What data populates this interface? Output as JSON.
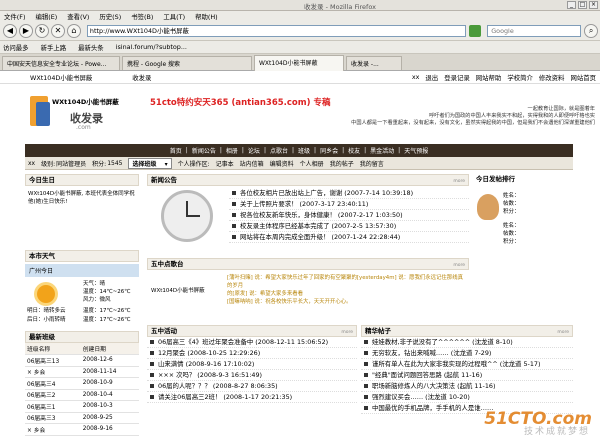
{
  "window": {
    "title": "收发录 - Mozilla Firefox"
  },
  "menu": [
    "文件(F)",
    "编辑(E)",
    "查看(V)",
    "历史(S)",
    "书签(B)",
    "工具(T)",
    "帮助(H)"
  ],
  "address_bar": {
    "url": "http://www.WXt104D小能书屏蔽",
    "search_placeholder": "Google"
  },
  "bookmarks": [
    "访问最多",
    "新手上路",
    "最新头条",
    "isinal.forum/?subtop..."
  ],
  "tabs": [
    "中国安天信息安全专业论坛 - Powe...",
    "携程 - Google 搜索",
    "WXt104D小能书屏蔽",
    "收发录 -..."
  ],
  "active_tab_index": 2,
  "top_links": {
    "left": "WXt104D小能书屏蔽",
    "middle": "收发录",
    "right": [
      "xx",
      "退出",
      "登录记录",
      "网站帮助",
      "学校简介",
      "修改资料",
      "网站首页"
    ]
  },
  "header": {
    "logo_text": "WXt104D小能书屏蔽",
    "logo_sub": "收发录",
    "logo_domain": ".com",
    "slogan": "51cto特约安天365 (antian365.com) 专稿",
    "intro": [
      "一起教育让国际，就是图着年",
      "呼吁者们为国政的中国人丰来我实不和起，实得我和的人即便呼吁格也实",
      "中国人都是一下看重起来，没有起来，没有文化，虽然实得起我的中国，但是我们不会遇他们深谋重建他们"
    ]
  },
  "main_nav": [
    "首页",
    "新闻公告",
    "相册",
    "论坛",
    "点歌台",
    "班级",
    "同乡会",
    "校友",
    "黑金活动",
    "天气预报"
  ],
  "sub_nav": {
    "user": "xx",
    "level_label": "级别:",
    "level": "同站管理员",
    "points_label": "积分:",
    "points": "1545",
    "class_select": "选择班级",
    "links": [
      "个人操作区:",
      "记事本",
      "站内信箱",
      "编辑资料",
      "个人相册",
      "我的帖子",
      "我的留言"
    ]
  },
  "birthday": {
    "title": "今日生日",
    "text": "WXt104D小能书屏蔽, 本班代表全体同学祝他(她)生日快乐!"
  },
  "weather": {
    "title": "本市天气",
    "city": "广州今日",
    "line1": "天气：晴",
    "line2": "温度：14℃~26℃",
    "line3": "风力：微风",
    "tomorrow_label": "明日：晴转多云",
    "tomorrow_temp": "温度：17℃~26℃",
    "after_label": "后日：小雨转晴",
    "after_temp": "温度：17℃~26℃"
  },
  "newest_class": {
    "title": "最新班级",
    "headers": [
      "班级名称",
      "创建日期"
    ],
    "rows": [
      [
        "06届高三13",
        "2008-12-6"
      ],
      [
        "× 乡会",
        "2008-11-14"
      ],
      [
        "06届高三4",
        "2008-10-9"
      ],
      [
        "06届高三2",
        "2008-10-4"
      ],
      [
        "06届高三1",
        "2008-10-3"
      ],
      [
        "06届高三3",
        "2008-9-25"
      ],
      [
        "×   乡会",
        "2008-9-16"
      ]
    ]
  },
  "news": {
    "title": "新闻公告",
    "more": "more",
    "items": [
      "各位校友相片已放出站上广告，谢谢  (2007-7-14 10:39:18)",
      "关于上传照片要求！  (2007-3-17 23:40:11)",
      "祝各位校友新年快乐，身体健康！  (2007-2-17 1:03:50)",
      "校友录主体程序已经基本完成了  (2007-2-5 13:57:30)",
      "网站将在本周内完成全面升级！  (2007-1-24 22:28:44)"
    ]
  },
  "today_star": {
    "title": "今日发帖排行",
    "fields": [
      "姓名：",
      "帖数：",
      "积分：",
      "姓名：",
      "帖数：",
      "积分："
    ]
  },
  "song": {
    "title": "五中点歌台",
    "more": "more",
    "left_text": "WXt104D小能书屏蔽",
    "messages": [
      "[蒲叶扫赌] 说：希望大家快乐过年了回家的有空聚聚的[yesterday4m] 说：愿我们永远记住那线真的岁月",
      "的[原发] 说：希望大家多来看看",
      "[国嘛呐呐] 说：祝各校快乐平长大，天天开开心心。"
    ]
  },
  "activities": {
    "title": "五中活动",
    "more": "more",
    "items": [
      "06届高三《4》班过年聚会准备中  (2008-12-11 15:06:52)",
      "12月聚会  (2008-10-25 12:29:26)",
      "山来满情  (2008-9-16 17:10:02)",
      "×××            次吗？  (2008-9-3 16:51:49)",
      "06届的人呢？？？  (2008-8-27 8:06:35)",
      "请关注06届高三2班！  (2008-1-17 20:21:35)"
    ]
  },
  "hot_posts": {
    "title": "精华帖子",
    "more": "more",
    "items": [
      "娃娃教材,非子说没有了^^^^^^  (沈龙道 8-10)",
      "无穷软友，钻出来喊喊……  (沈龙道 7-29)",
      "谨所有单人在此为大家非我实现的过程哦^^  (沈龙道 5-17)",
      "\"经典\"面试问题回答思路  (起航 11-16)",
      "职场新脑修炼人的八大决策法  (起航 11-16)",
      "强烈建议买会……  (沈龙道 10-20)",
      "中国最优的手机品牌，手手机的人是谁……"
    ]
  },
  "watermark": {
    "text": "51CTO.com",
    "sub": "技术成就梦想"
  },
  "colors": {
    "nav_bg": "#3a2e22",
    "slogan": "#dd2222",
    "accent": "#f0a030"
  }
}
